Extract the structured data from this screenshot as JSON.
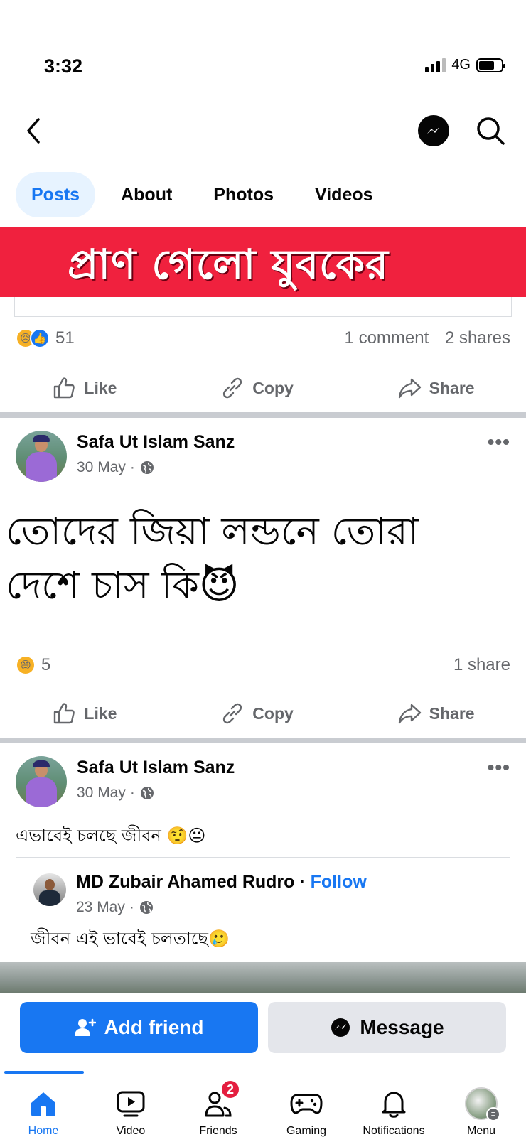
{
  "status_bar": {
    "time": "3:32",
    "network": "4G"
  },
  "tabs": [
    {
      "label": "Posts",
      "active": true
    },
    {
      "label": "About",
      "active": false
    },
    {
      "label": "Photos",
      "active": false
    },
    {
      "label": "Videos",
      "active": false
    }
  ],
  "banner": {
    "text": "প্রাণ গেলো যুবকের",
    "color": "#f0213e"
  },
  "post0": {
    "reaction_count": "51",
    "comments": "1 comment",
    "shares": "2 shares",
    "actions": {
      "like": "Like",
      "copy": "Copy",
      "share": "Share"
    }
  },
  "post1": {
    "author": "Safa Ut Islam Sanz",
    "date": "30 May",
    "text_line1": "তোদের জিয়া লন্ডনে তোরা",
    "text_line2": "দেশে চাস কি😈",
    "reaction_count": "5",
    "shares": "1 share",
    "actions": {
      "like": "Like",
      "copy": "Copy",
      "share": "Share"
    }
  },
  "post2": {
    "author": "Safa Ut Islam Sanz",
    "date": "30 May",
    "text": "এভাবেই চলছে জীবন 🤨😐",
    "shared": {
      "author": "MD Zubair Ahamed Rudro",
      "follow": "Follow",
      "date": "23 May",
      "text": "জীবন এই ভাবেই চলতাছে🥲"
    }
  },
  "cta": {
    "add_friend": "Add friend",
    "message": "Message"
  },
  "bottom_nav": {
    "home": "Home",
    "video": "Video",
    "friends": "Friends",
    "friends_badge": "2",
    "gaming": "Gaming",
    "notifications": "Notifications",
    "menu": "Menu"
  },
  "colors": {
    "accent": "#1877f2",
    "badge": "#e41e3f"
  }
}
